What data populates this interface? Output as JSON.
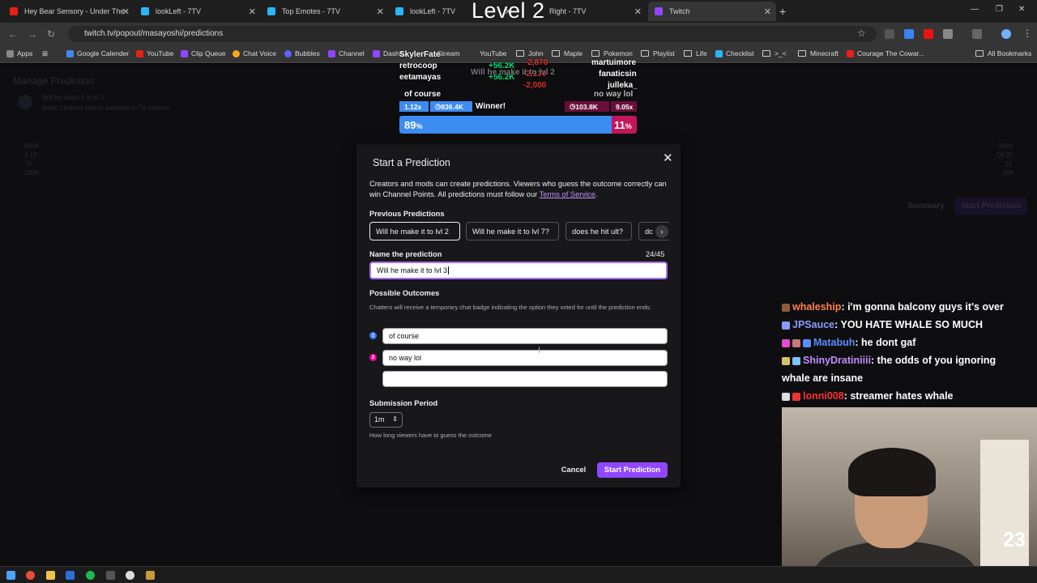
{
  "overlay_title": "Level 2",
  "tabs": [
    {
      "label": "Hey Bear Sensory - Under The",
      "color": "#e62117"
    },
    {
      "label": "lookLeft - 7TV",
      "color": "#29b6f6"
    },
    {
      "label": "Top Emotes - 7TV",
      "color": "#29b6f6"
    },
    {
      "label": "lookLeft - 7TV",
      "color": "#29b6f6"
    },
    {
      "label": "Right - 7TV",
      "color": "#29b6f6"
    },
    {
      "label": "Twitch",
      "color": "#9146ff"
    }
  ],
  "address": {
    "url": "twitch.tv/popout/masayoshi/predictions"
  },
  "bookmarks": [
    {
      "label": "Apps",
      "icon": "apps-grid-icon"
    },
    {
      "label": "Google Calender",
      "icon": "calendar-icon"
    },
    {
      "label": "YouTube",
      "icon": "youtube-icon"
    },
    {
      "label": "Clip Queue",
      "icon": "clip-icon"
    },
    {
      "label": "Chat Voice",
      "icon": "voice-icon"
    },
    {
      "label": "Bubbles",
      "icon": "discord-icon"
    },
    {
      "label": "Channel",
      "icon": "twitch-icon"
    },
    {
      "label": "Dashb",
      "icon": "twitch-icon"
    },
    {
      "label": "Stream",
      "icon": "folder-icon"
    },
    {
      "label": "YouTube",
      "icon": "folder-icon"
    },
    {
      "label": "John",
      "icon": "folder-icon"
    },
    {
      "label": "Maple",
      "icon": "folder-icon"
    },
    {
      "label": "Pokemon",
      "icon": "folder-icon"
    },
    {
      "label": "Playlist",
      "icon": "folder-icon"
    },
    {
      "label": "Life",
      "icon": "folder-icon"
    },
    {
      "label": "Checklist",
      "icon": "check-icon"
    },
    {
      "label": ">_<",
      "icon": "folder-icon"
    },
    {
      "label": "Minecraft",
      "icon": "folder-icon"
    },
    {
      "label": "Courage The Cowar...",
      "icon": "youtube-icon"
    },
    {
      "label": "All Bookmarks",
      "icon": "folder-icon"
    }
  ],
  "background": {
    "heading": "Manage Prediction",
    "pred_title": "Will he make it to lvl 2",
    "pred_sub": "940K Channel Points awarded to 76 viewers",
    "left_stats": [
      "836K",
      "1.12",
      "76",
      "200K"
    ],
    "right_stats": [
      "104K",
      "18.05",
      "21",
      "55K"
    ],
    "summary_label": "Summary",
    "start_label": "Start Prediction"
  },
  "stream_overlay": {
    "names_left": [
      "SkylerFate",
      "retrocoop",
      "eetamayas"
    ],
    "amounts_green": [
      "+56.2K",
      "+56.2K"
    ],
    "amounts_red": [
      "-2,870",
      "-2,130",
      "-2,000"
    ],
    "names_right": [
      "martuimore",
      "fanaticsin",
      "julleka_"
    ],
    "question": "Will he make it to lvl 2",
    "outcome_left": "of course",
    "outcome_right": "no way lol",
    "left_ratio": "1.12x",
    "left_points": "836.4K",
    "winner_label": "Winner!",
    "right_points": "103.8K",
    "right_ratio": "9.05x",
    "left_pct": "89",
    "right_pct": "11",
    "pct_sign": "%"
  },
  "modal": {
    "title": "Start a Prediction",
    "desc": "Creators and mods can create predictions. Viewers who guess the outcome correctly can win Channel Points. All predictions must follow our",
    "terms_link": "Terms of Service",
    "period_char": ".",
    "previous_label": "Previous Predictions",
    "previous": [
      "Will he make it to lvl 2",
      "Will he make it to lvl 7?",
      "does he hit ult?",
      "dc"
    ],
    "name_label": "Name the prediction",
    "name_counter": "24/45",
    "name_value": "Will he make it to lvl 3",
    "outcomes_label": "Possible Outcomes",
    "outcomes_hint": "Chatters will receive a temporary chat badge indicating the option they voted for until the prediction ends.",
    "outcomes": [
      {
        "num": "1",
        "value": "of course",
        "color": "#387aff"
      },
      {
        "num": "2",
        "value": "no way lol",
        "color": "#f5009b"
      },
      {
        "num": "",
        "value": "",
        "color": ""
      }
    ],
    "period_label": "Submission Period",
    "period_value": "1m",
    "period_hint": "How long viewers have to guess the outcome",
    "cancel": "Cancel",
    "start": "Start Prediction"
  },
  "chat": [
    {
      "user": "whaleship",
      "color": "#ff7f50",
      "text": ": i'm gonna balcony guys it's over"
    },
    {
      "user": "JPSauce",
      "color": "#8a9bff",
      "text": ": YOU HATE WHALE SO MUCH"
    },
    {
      "user": "Matabuh",
      "color": "#5b8cff",
      "text": ": he dont gaf"
    },
    {
      "user": "ShinyDratiniiii",
      "color": "#c58cff",
      "text": ": the odds of you ignoring"
    },
    {
      "user": "",
      "color": "#ffffff",
      "text": "whale are insane"
    },
    {
      "user": "lonni008",
      "color": "#ff3030",
      "text": ": streamer hates whale"
    }
  ],
  "webcam_number": "23"
}
